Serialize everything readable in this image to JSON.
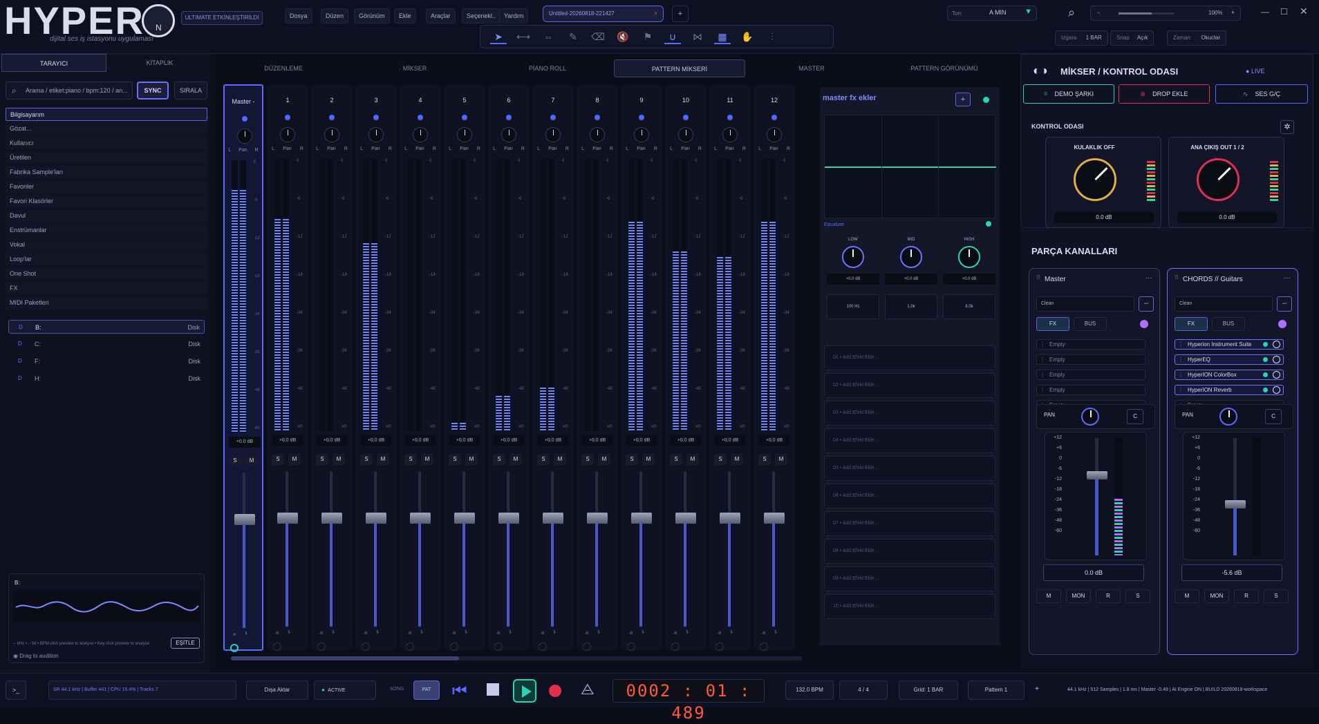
{
  "app": {
    "logo": "HYPER",
    "logo_mark": "N",
    "subtitle": "dijital ses iş istasyonu uygulaması",
    "badge": "ULTIMATE ETKİNLEŞTİRİLDİ"
  },
  "menu": [
    "Dosya",
    "Düzen",
    "Görünüm",
    "Ekle",
    "Araçlar",
    "Seçenekl..",
    "Yardım"
  ],
  "file_tab": "Untitled-20260818-221427",
  "new_tab": "+",
  "key": {
    "label": "Ton:",
    "value": "A MIN"
  },
  "zoom": {
    "minus": "-",
    "value": "100%",
    "plus": "+"
  },
  "grid_bar": {
    "izgara_label": "Izgara",
    "izgara_value": "1 BAR",
    "snap_label": "Snap",
    "snap_value": "Açık",
    "zaman_label": "Zaman",
    "zaman_value": "Okuclar"
  },
  "left": {
    "tabs": [
      "TARAYICI",
      "KİTAPLIK"
    ],
    "search_placeholder": "Arama / etiket:piano / bpm:120 / an...",
    "sync": "SYNC",
    "sort": "SIRALA",
    "items": [
      "Bilgisayarım",
      "Gözat...",
      "Kullanıcı",
      "Üretilen",
      "Fabrika Sample'ları",
      "Favoriler",
      "Favori Klasörler",
      "Davul",
      "Enstrümanlar",
      "Vokal",
      "Loop'lar",
      "One Shot",
      "FX",
      "MIDI Paketleri"
    ],
    "drives": [
      {
        "tag": "D",
        "name": "B:",
        "type": "Disk"
      },
      {
        "tag": "D",
        "name": "C:",
        "type": "Disk"
      },
      {
        "tag": "D",
        "name": "F:",
        "type": "Disk"
      },
      {
        "tag": "D",
        "name": "H:",
        "type": "Disk"
      }
    ],
    "preview": {
      "title": "B:",
      "hint": "-- kHz  •  -- bit  •  BPM click preview to analyse  •  Key click preview to analyse",
      "eq_btn": "EŞİTLE",
      "drag": "Drag to audition"
    }
  },
  "center_tabs": [
    "DÜZENLEME",
    "MİKSER",
    "PİANO ROLL",
    "PATTERN MİKSERİ",
    "MASTER",
    "PATTERN GÖRÜNÜMÜ"
  ],
  "mixer": {
    "strips": [
      {
        "name": "Master -",
        "level": 0.89
      },
      {
        "name": "1",
        "level": 0.78
      },
      {
        "name": "2",
        "level": 0
      },
      {
        "name": "3",
        "level": 0.69
      },
      {
        "name": "4",
        "level": 0
      },
      {
        "name": "5",
        "level": 0.03
      },
      {
        "name": "6",
        "level": 0.13
      },
      {
        "name": "7",
        "level": 0.16
      },
      {
        "name": "8",
        "level": 0
      },
      {
        "name": "9",
        "level": 0.77
      },
      {
        "name": "10",
        "level": 0.66
      },
      {
        "name": "11",
        "level": 0.64
      },
      {
        "name": "12",
        "level": 0.77
      }
    ],
    "pan_l": "L",
    "pan_label": "Pan",
    "pan_r": "R",
    "db_text": "+0.0 dB",
    "solo": "S",
    "mute": "M",
    "scale": [
      "0",
      "-6",
      "-12",
      "-18",
      "-24",
      "-36",
      "-48",
      "-60"
    ]
  },
  "fx": {
    "title": "master fx ekler",
    "eq_title": "Equalizer",
    "bands": [
      {
        "name": "LOW",
        "gain": "+0.0 dB",
        "freq": "100 Hz"
      },
      {
        "name": "MID",
        "gain": "+0.0 dB",
        "freq": "1.0k"
      },
      {
        "name": "HIGH",
        "gain": "+0.0 dB",
        "freq": "8.0k"
      }
    ],
    "slots": [
      "01 • Add Efekt Ekle...",
      "02 • Add Efekt Ekle...",
      "03 • Add Efekt Ekle...",
      "04 • Add Efekt Ekle...",
      "05 • Add Efekt Ekle...",
      "06 • Add Efekt Ekle...",
      "07 • Add Efekt Ekle...",
      "08 • Add Efekt Ekle...",
      "09 • Add Efekt Ekle...",
      "10 • Add Efekt Ekle..."
    ]
  },
  "right": {
    "title": "MİKSER / KONTROL ODASI",
    "live": "LIVE",
    "actions": [
      "DEMO ŞARKI",
      "DROP EKLE",
      "SES G/Ç"
    ],
    "control_title": "KONTROL ODASI",
    "cards": [
      {
        "title": "KULAKLIK OFF",
        "value": "0.0 dB"
      },
      {
        "title": "ANA ÇIKIŞ OUT 1 / 2",
        "value": "0.0 dB"
      }
    ],
    "channels_title": "PARÇA KANALLARI",
    "channels": [
      {
        "name": "Master",
        "preset": "Clean",
        "fx": "FX",
        "bus": "BUS",
        "plugins": [
          "Empty",
          "Empty",
          "Empty",
          "Empty",
          "Empty"
        ],
        "pan": "PAN",
        "pan_c": "C",
        "value": "0.0 dB",
        "buttons": [
          "M",
          "MON",
          "R",
          "S"
        ]
      },
      {
        "name": "CHORDS // Guitars",
        "preset": "Clean",
        "fx": "FX",
        "bus": "BUS",
        "plugins": [
          "Hyperion Instrument Suite",
          "HyperEQ",
          "HyperION ColorBox",
          "HyperION Reverb",
          "Empty"
        ],
        "pan": "PAN",
        "pan_c": "C",
        "value": "-5.6 dB",
        "buttons": [
          "M",
          "MON",
          "R",
          "S"
        ]
      }
    ],
    "scale": [
      "+12",
      "+6",
      "0",
      "-6",
      "-12",
      "-18",
      "-24",
      "-36",
      "-48",
      "-60"
    ]
  },
  "bottom": {
    "stats": "SR 44.1 kHz  |  Buffer 441  |  CPU 15.4%  |  Tracks 7",
    "export": "Dışa Aktar",
    "active": "ACTIVE",
    "song": "SONG",
    "pat": "PAT",
    "time": "0002 : 01 : 489",
    "bpm": "132.0 BPM",
    "sig": "4 / 4",
    "grid": "Grid: 1 BAR",
    "pattern": "Pattern 1",
    "add": "+",
    "status": "44.1 kHz  |  512 Samples  |  1.8 ms  |  Master -0.49  |  AI Engine ON  |  BUILD 20260818-workspace"
  },
  "colors": {
    "accent": "#5a6bff",
    "meter": "#6f86ff",
    "rec": "#e0304a",
    "play": "#2ad4b4",
    "time": "#ff5a3c"
  }
}
